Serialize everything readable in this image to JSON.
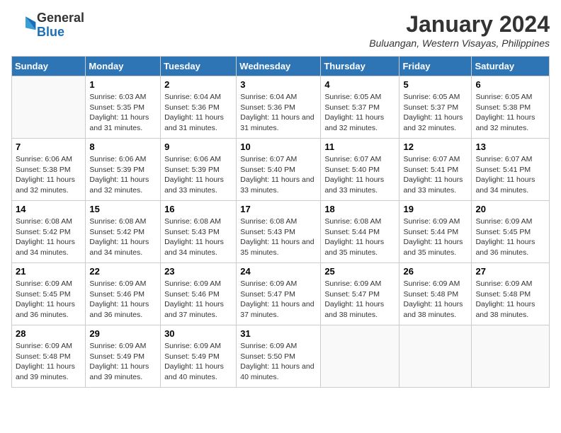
{
  "header": {
    "logo": {
      "line1": "General",
      "line2": "Blue"
    },
    "title": "January 2024",
    "location": "Buluangan, Western Visayas, Philippines"
  },
  "weekdays": [
    "Sunday",
    "Monday",
    "Tuesday",
    "Wednesday",
    "Thursday",
    "Friday",
    "Saturday"
  ],
  "weeks": [
    [
      {
        "day": "",
        "sunrise": "",
        "sunset": "",
        "daylight": ""
      },
      {
        "day": "1",
        "sunrise": "6:03 AM",
        "sunset": "5:35 PM",
        "daylight": "11 hours and 31 minutes."
      },
      {
        "day": "2",
        "sunrise": "6:04 AM",
        "sunset": "5:36 PM",
        "daylight": "11 hours and 31 minutes."
      },
      {
        "day": "3",
        "sunrise": "6:04 AM",
        "sunset": "5:36 PM",
        "daylight": "11 hours and 31 minutes."
      },
      {
        "day": "4",
        "sunrise": "6:05 AM",
        "sunset": "5:37 PM",
        "daylight": "11 hours and 32 minutes."
      },
      {
        "day": "5",
        "sunrise": "6:05 AM",
        "sunset": "5:37 PM",
        "daylight": "11 hours and 32 minutes."
      },
      {
        "day": "6",
        "sunrise": "6:05 AM",
        "sunset": "5:38 PM",
        "daylight": "11 hours and 32 minutes."
      }
    ],
    [
      {
        "day": "7",
        "sunrise": "6:06 AM",
        "sunset": "5:38 PM",
        "daylight": "11 hours and 32 minutes."
      },
      {
        "day": "8",
        "sunrise": "6:06 AM",
        "sunset": "5:39 PM",
        "daylight": "11 hours and 32 minutes."
      },
      {
        "day": "9",
        "sunrise": "6:06 AM",
        "sunset": "5:39 PM",
        "daylight": "11 hours and 33 minutes."
      },
      {
        "day": "10",
        "sunrise": "6:07 AM",
        "sunset": "5:40 PM",
        "daylight": "11 hours and 33 minutes."
      },
      {
        "day": "11",
        "sunrise": "6:07 AM",
        "sunset": "5:40 PM",
        "daylight": "11 hours and 33 minutes."
      },
      {
        "day": "12",
        "sunrise": "6:07 AM",
        "sunset": "5:41 PM",
        "daylight": "11 hours and 33 minutes."
      },
      {
        "day": "13",
        "sunrise": "6:07 AM",
        "sunset": "5:41 PM",
        "daylight": "11 hours and 34 minutes."
      }
    ],
    [
      {
        "day": "14",
        "sunrise": "6:08 AM",
        "sunset": "5:42 PM",
        "daylight": "11 hours and 34 minutes."
      },
      {
        "day": "15",
        "sunrise": "6:08 AM",
        "sunset": "5:42 PM",
        "daylight": "11 hours and 34 minutes."
      },
      {
        "day": "16",
        "sunrise": "6:08 AM",
        "sunset": "5:43 PM",
        "daylight": "11 hours and 34 minutes."
      },
      {
        "day": "17",
        "sunrise": "6:08 AM",
        "sunset": "5:43 PM",
        "daylight": "11 hours and 35 minutes."
      },
      {
        "day": "18",
        "sunrise": "6:08 AM",
        "sunset": "5:44 PM",
        "daylight": "11 hours and 35 minutes."
      },
      {
        "day": "19",
        "sunrise": "6:09 AM",
        "sunset": "5:44 PM",
        "daylight": "11 hours and 35 minutes."
      },
      {
        "day": "20",
        "sunrise": "6:09 AM",
        "sunset": "5:45 PM",
        "daylight": "11 hours and 36 minutes."
      }
    ],
    [
      {
        "day": "21",
        "sunrise": "6:09 AM",
        "sunset": "5:45 PM",
        "daylight": "11 hours and 36 minutes."
      },
      {
        "day": "22",
        "sunrise": "6:09 AM",
        "sunset": "5:46 PM",
        "daylight": "11 hours and 36 minutes."
      },
      {
        "day": "23",
        "sunrise": "6:09 AM",
        "sunset": "5:46 PM",
        "daylight": "11 hours and 37 minutes."
      },
      {
        "day": "24",
        "sunrise": "6:09 AM",
        "sunset": "5:47 PM",
        "daylight": "11 hours and 37 minutes."
      },
      {
        "day": "25",
        "sunrise": "6:09 AM",
        "sunset": "5:47 PM",
        "daylight": "11 hours and 38 minutes."
      },
      {
        "day": "26",
        "sunrise": "6:09 AM",
        "sunset": "5:48 PM",
        "daylight": "11 hours and 38 minutes."
      },
      {
        "day": "27",
        "sunrise": "6:09 AM",
        "sunset": "5:48 PM",
        "daylight": "11 hours and 38 minutes."
      }
    ],
    [
      {
        "day": "28",
        "sunrise": "6:09 AM",
        "sunset": "5:48 PM",
        "daylight": "11 hours and 39 minutes."
      },
      {
        "day": "29",
        "sunrise": "6:09 AM",
        "sunset": "5:49 PM",
        "daylight": "11 hours and 39 minutes."
      },
      {
        "day": "30",
        "sunrise": "6:09 AM",
        "sunset": "5:49 PM",
        "daylight": "11 hours and 40 minutes."
      },
      {
        "day": "31",
        "sunrise": "6:09 AM",
        "sunset": "5:50 PM",
        "daylight": "11 hours and 40 minutes."
      },
      {
        "day": "",
        "sunrise": "",
        "sunset": "",
        "daylight": ""
      },
      {
        "day": "",
        "sunrise": "",
        "sunset": "",
        "daylight": ""
      },
      {
        "day": "",
        "sunrise": "",
        "sunset": "",
        "daylight": ""
      }
    ]
  ],
  "labels": {
    "sunrise_prefix": "Sunrise: ",
    "sunset_prefix": "Sunset: ",
    "daylight_prefix": "Daylight: "
  }
}
